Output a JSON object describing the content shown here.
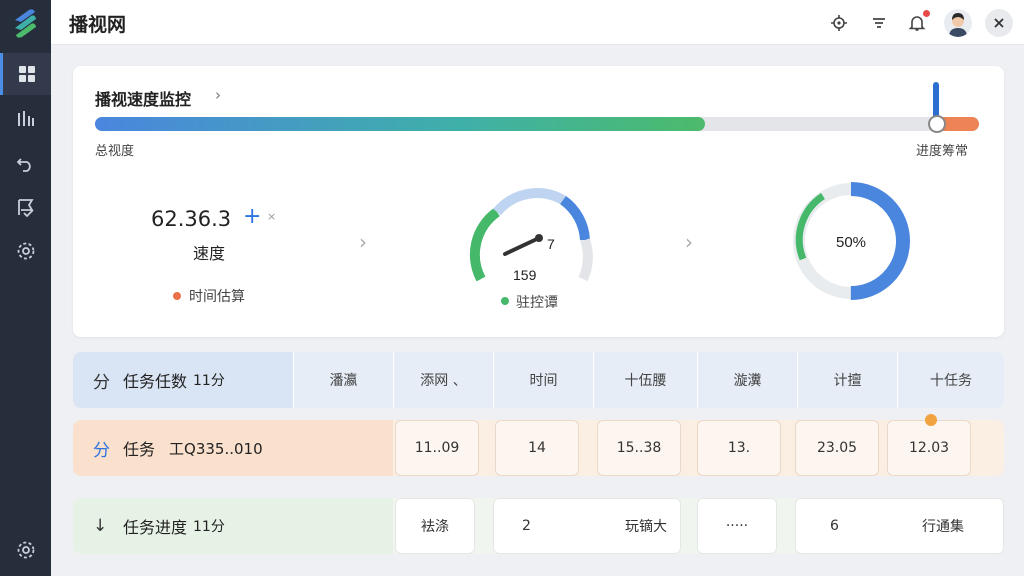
{
  "app": {
    "title": "播视网"
  },
  "sidebar": {
    "items": [
      {
        "name": "dashboard",
        "icon": "grid-icon",
        "active": true
      },
      {
        "name": "stats",
        "icon": "bar-chart-icon",
        "active": false
      },
      {
        "name": "history",
        "icon": "undo-icon",
        "active": false
      },
      {
        "name": "tasks",
        "icon": "flag-list-icon",
        "active": false
      },
      {
        "name": "settings",
        "icon": "gear-icon",
        "active": false
      }
    ],
    "bottom_icon": "gear-icon"
  },
  "topbar": {
    "icons": [
      "target-icon",
      "filter-icon",
      "bell-icon",
      "avatar",
      "close-icon"
    ]
  },
  "monitor": {
    "title": "播视速度监控",
    "progress_label_left": "总视度",
    "progress_label_right": "进度筹常",
    "progress_value": 0.69,
    "stat_value": "62.36.3",
    "stat_plus": "+",
    "stat_x": "×",
    "stat_label": "速度",
    "stat_sub": "时间估算",
    "gauge_value_top": "7",
    "gauge_value_bottom": "159",
    "gauge_label": "驻控谭",
    "donut_label": "50%",
    "donut_value": 0.5
  },
  "table": {
    "header": {
      "icon": "分",
      "label": "任务任数",
      "count": "11分",
      "columns": [
        "潘瀛",
        "添网 、",
        "时间",
        "十伍腰",
        "漩瀵",
        "计擅",
        "十任务"
      ]
    },
    "row_task": {
      "icon": "分",
      "label": "任务",
      "code": "工Q335..010",
      "values": [
        "11..09",
        "14",
        "15..38",
        "13.",
        "23.05",
        "12.03"
      ]
    },
    "row_progress": {
      "icon": "↓",
      "label": "任务进度",
      "count": "11分",
      "values": [
        "袪涤",
        "2",
        "玩镝大",
        "·····",
        "6",
        "行通集"
      ]
    }
  },
  "colors": {
    "sidebar": "#262d3b",
    "accent_blue": "#4a86de",
    "accent_green": "#4cbb6c",
    "accent_orange": "#ee8355"
  }
}
